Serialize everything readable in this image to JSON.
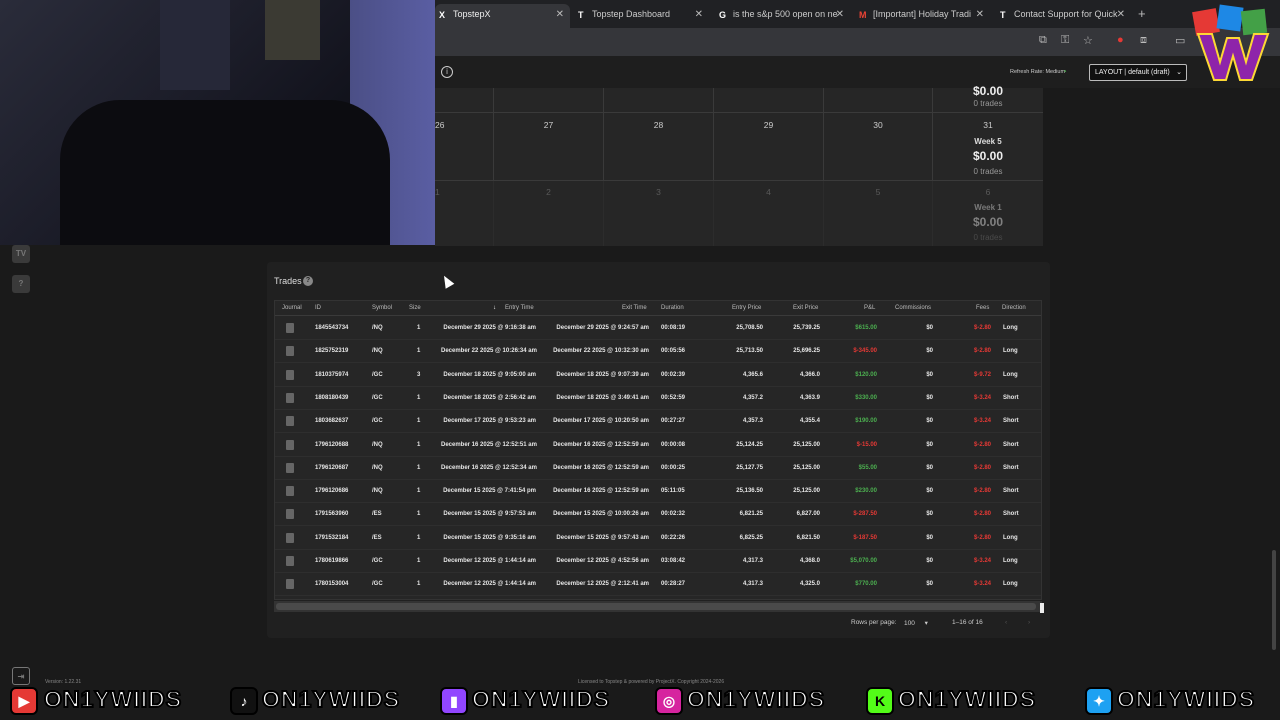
{
  "browser": {
    "tabs": [
      {
        "label": "TopstepX",
        "icon": "X",
        "active": true
      },
      {
        "label": "Topstep Dashboard",
        "icon": "T",
        "active": false
      },
      {
        "label": "is the s&p 500 open on ne",
        "icon": "G",
        "active": false
      },
      {
        "label": "[Important] Holiday Tradi",
        "icon": "M",
        "active": false
      },
      {
        "label": "Contact Support for Quick",
        "icon": "T",
        "active": false
      }
    ],
    "new_tab": "+"
  },
  "header": {
    "refresh_rate": "Refresh Rate: Medium",
    "layout_select": "LAYOUT | default (draft)"
  },
  "calendar": {
    "row1": {
      "week_amount": "$0.00",
      "week_trades": "0 trades"
    },
    "row2": {
      "days": [
        "26",
        "27",
        "28",
        "29",
        "30",
        "31"
      ],
      "week_label": "Week 5",
      "week_amount": "$0.00",
      "week_trades": "0 trades"
    },
    "row3": {
      "days": [
        "1",
        "2",
        "3",
        "4",
        "5",
        "6"
      ],
      "week_label": "Week 1",
      "week_amount": "$0.00",
      "week_trades": "0 trades"
    }
  },
  "trades": {
    "title": "Trades",
    "columns": [
      "Journal",
      "ID",
      "Symbol",
      "Size",
      "Entry Time",
      "Exit Time",
      "Duration",
      "Entry Price",
      "Exit Price",
      "P&L",
      "Commissions",
      "Fees",
      "Direction"
    ],
    "rows": [
      {
        "id": "1845543734",
        "symbol": "/NQ",
        "size": "1",
        "entry_time": "December 29 2025 @ 9:16:38 am",
        "exit_time": "December 29 2025 @ 9:24:57 am",
        "duration": "00:08:19",
        "entry_price": "25,708.50",
        "exit_price": "25,739.25",
        "pnl": "$615.00",
        "pnl_sign": "pos",
        "commissions": "$0",
        "fees": "$-2.80",
        "direction": "Long"
      },
      {
        "id": "1825752319",
        "symbol": "/NQ",
        "size": "1",
        "entry_time": "December 22 2025 @ 10:26:34 am",
        "exit_time": "December 22 2025 @ 10:32:30 am",
        "duration": "00:05:56",
        "entry_price": "25,713.50",
        "exit_price": "25,696.25",
        "pnl": "$-345.00",
        "pnl_sign": "neg",
        "commissions": "$0",
        "fees": "$-2.80",
        "direction": "Long"
      },
      {
        "id": "1810375974",
        "symbol": "/GC",
        "size": "3",
        "entry_time": "December 18 2025 @ 9:05:00 am",
        "exit_time": "December 18 2025 @ 9:07:39 am",
        "duration": "00:02:39",
        "entry_price": "4,365.6",
        "exit_price": "4,366.0",
        "pnl": "$120.00",
        "pnl_sign": "pos",
        "commissions": "$0",
        "fees": "$-9.72",
        "direction": "Long"
      },
      {
        "id": "1808180439",
        "symbol": "/GC",
        "size": "1",
        "entry_time": "December 18 2025 @ 2:56:42 am",
        "exit_time": "December 18 2025 @ 3:49:41 am",
        "duration": "00:52:59",
        "entry_price": "4,357.2",
        "exit_price": "4,363.9",
        "pnl": "$330.00",
        "pnl_sign": "pos",
        "commissions": "$0",
        "fees": "$-3.24",
        "direction": "Short"
      },
      {
        "id": "1803682637",
        "symbol": "/GC",
        "size": "1",
        "entry_time": "December 17 2025 @ 9:53:23 am",
        "exit_time": "December 17 2025 @ 10:20:50 am",
        "duration": "00:27:27",
        "entry_price": "4,357.3",
        "exit_price": "4,355.4",
        "pnl": "$190.00",
        "pnl_sign": "pos",
        "commissions": "$0",
        "fees": "$-3.24",
        "direction": "Short"
      },
      {
        "id": "1796120688",
        "symbol": "/NQ",
        "size": "1",
        "entry_time": "December 16 2025 @ 12:52:51 am",
        "exit_time": "December 16 2025 @ 12:52:59 am",
        "duration": "00:00:08",
        "entry_price": "25,124.25",
        "exit_price": "25,125.00",
        "pnl": "$-15.00",
        "pnl_sign": "neg",
        "commissions": "$0",
        "fees": "$-2.80",
        "direction": "Short"
      },
      {
        "id": "1796120687",
        "symbol": "/NQ",
        "size": "1",
        "entry_time": "December 16 2025 @ 12:52:34 am",
        "exit_time": "December 16 2025 @ 12:52:59 am",
        "duration": "00:00:25",
        "entry_price": "25,127.75",
        "exit_price": "25,125.00",
        "pnl": "$55.00",
        "pnl_sign": "pos",
        "commissions": "$0",
        "fees": "$-2.80",
        "direction": "Short"
      },
      {
        "id": "1796120686",
        "symbol": "/NQ",
        "size": "1",
        "entry_time": "December 15 2025 @ 7:41:54 pm",
        "exit_time": "December 16 2025 @ 12:52:59 am",
        "duration": "05:11:05",
        "entry_price": "25,136.50",
        "exit_price": "25,125.00",
        "pnl": "$230.00",
        "pnl_sign": "pos",
        "commissions": "$0",
        "fees": "$-2.80",
        "direction": "Short"
      },
      {
        "id": "1791563960",
        "symbol": "/ES",
        "size": "1",
        "entry_time": "December 15 2025 @ 9:57:53 am",
        "exit_time": "December 15 2025 @ 10:00:26 am",
        "duration": "00:02:32",
        "entry_price": "6,821.25",
        "exit_price": "6,827.00",
        "pnl": "$-287.50",
        "pnl_sign": "neg",
        "commissions": "$0",
        "fees": "$-2.80",
        "direction": "Short"
      },
      {
        "id": "1791532184",
        "symbol": "/ES",
        "size": "1",
        "entry_time": "December 15 2025 @ 9:35:16 am",
        "exit_time": "December 15 2025 @ 9:57:43 am",
        "duration": "00:22:26",
        "entry_price": "6,825.25",
        "exit_price": "6,821.50",
        "pnl": "$-187.50",
        "pnl_sign": "neg",
        "commissions": "$0",
        "fees": "$-2.80",
        "direction": "Long"
      },
      {
        "id": "1780619866",
        "symbol": "/GC",
        "size": "1",
        "entry_time": "December 12 2025 @ 1:44:14 am",
        "exit_time": "December 12 2025 @ 4:52:56 am",
        "duration": "03:08:42",
        "entry_price": "4,317.3",
        "exit_price": "4,368.0",
        "pnl": "$5,070.00",
        "pnl_sign": "pos",
        "commissions": "$0",
        "fees": "$-3.24",
        "direction": "Long"
      },
      {
        "id": "1780153004",
        "symbol": "/GC",
        "size": "1",
        "entry_time": "December 12 2025 @ 1:44:14 am",
        "exit_time": "December 12 2025 @ 2:12:41 am",
        "duration": "00:28:27",
        "entry_price": "4,317.3",
        "exit_price": "4,325.0",
        "pnl": "$770.00",
        "pnl_sign": "pos",
        "commissions": "$0",
        "fees": "$-3.24",
        "direction": "Long"
      }
    ],
    "pagination": {
      "rows_per_page_label": "Rows per page:",
      "rows_per_page": "100",
      "range": "1–16 of 16"
    }
  },
  "footer": {
    "version": "Version: 1.22.31",
    "license": "Licensed to Topstep & powered by ProjectX. Copyright 2024-2026"
  },
  "social": {
    "handle": "ON1YWIIDS"
  },
  "colors": {
    "positive": "#4caf50",
    "negative": "#e53935",
    "background": "#1a1a1a"
  }
}
